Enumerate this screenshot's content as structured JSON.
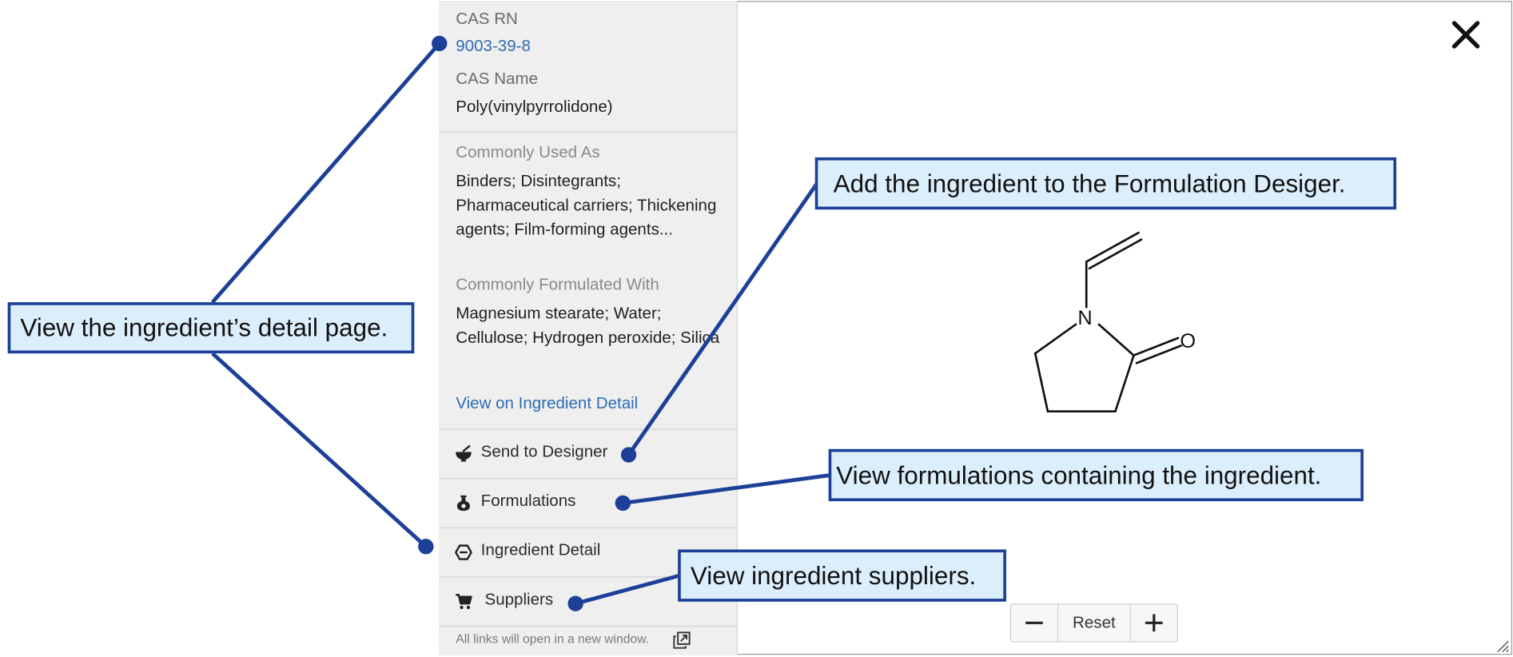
{
  "sidebar": {
    "cas_rn_label": "CAS RN",
    "cas_rn_value": "9003-39-8",
    "cas_name_label": "CAS Name",
    "cas_name_value": "Poly(vinylpyrrolidone)",
    "used_as_label": "Commonly Used As",
    "used_as_value": "Binders; Disintegrants; Pharmaceutical carriers; Thickening agents; Film-forming agents...",
    "formulated_with_label": "Commonly Formulated With",
    "formulated_with_value": "Magnesium stearate; Water; Cellulose; Hydrogen peroxide; Silica",
    "view_link": "View on Ingredient Detail",
    "actions": [
      {
        "label": "Send to Designer",
        "icon": "mortar-pestle-icon"
      },
      {
        "label": "Formulations",
        "icon": "flask-icon"
      },
      {
        "label": "Ingredient Detail",
        "icon": "hexagon-icon"
      },
      {
        "label": "Suppliers",
        "icon": "cart-icon"
      }
    ],
    "footer": "All links will open in a new window."
  },
  "structure": {
    "atom_n": "N",
    "atom_o": "O"
  },
  "zoom": {
    "reset_label": "Reset"
  },
  "callouts": {
    "detail_page": "View the ingredient’s detail page.",
    "designer": "Add the ingredient to the Formulation Desiger.",
    "formulations": "View formulations containing the ingredient.",
    "suppliers": "View ingredient suppliers."
  },
  "colors": {
    "callout_border": "#1c3f97",
    "callout_fill": "#dbeefb",
    "link": "#2e6db4"
  }
}
